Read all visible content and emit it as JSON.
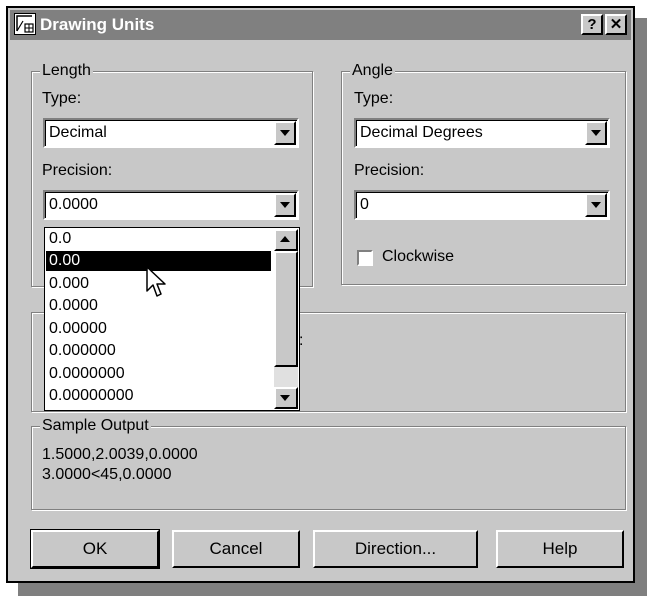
{
  "window": {
    "title": "Drawing Units",
    "help_label": "?",
    "close_label": "✕"
  },
  "length": {
    "legend": "Length",
    "type_label": "Type:",
    "type_value": "Decimal",
    "precision_label": "Precision:",
    "precision_value": "0.0000",
    "precision_options": [
      "0.0",
      "0.00",
      "0.000",
      "0.0000",
      "0.00000",
      "0.000000",
      "0.0000000",
      "0.00000000"
    ],
    "highlighted_option": "0.00"
  },
  "angle": {
    "legend": "Angle",
    "type_label": "Type:",
    "type_value": "Decimal Degrees",
    "precision_label": "Precision:",
    "precision_value": "0",
    "clockwise_label": "Clockwise",
    "clockwise_checked": false
  },
  "middle_partial_text": ":",
  "sample": {
    "legend": "Sample Output",
    "line1": "1.5000,2.0039,0.0000",
    "line2": "3.0000<45,0.0000"
  },
  "buttons": {
    "ok": "OK",
    "cancel": "Cancel",
    "direction": "Direction...",
    "help": "Help"
  },
  "colors": {
    "face": "#c8c8c8",
    "title_bar": "#808080",
    "selection": "#000000"
  }
}
